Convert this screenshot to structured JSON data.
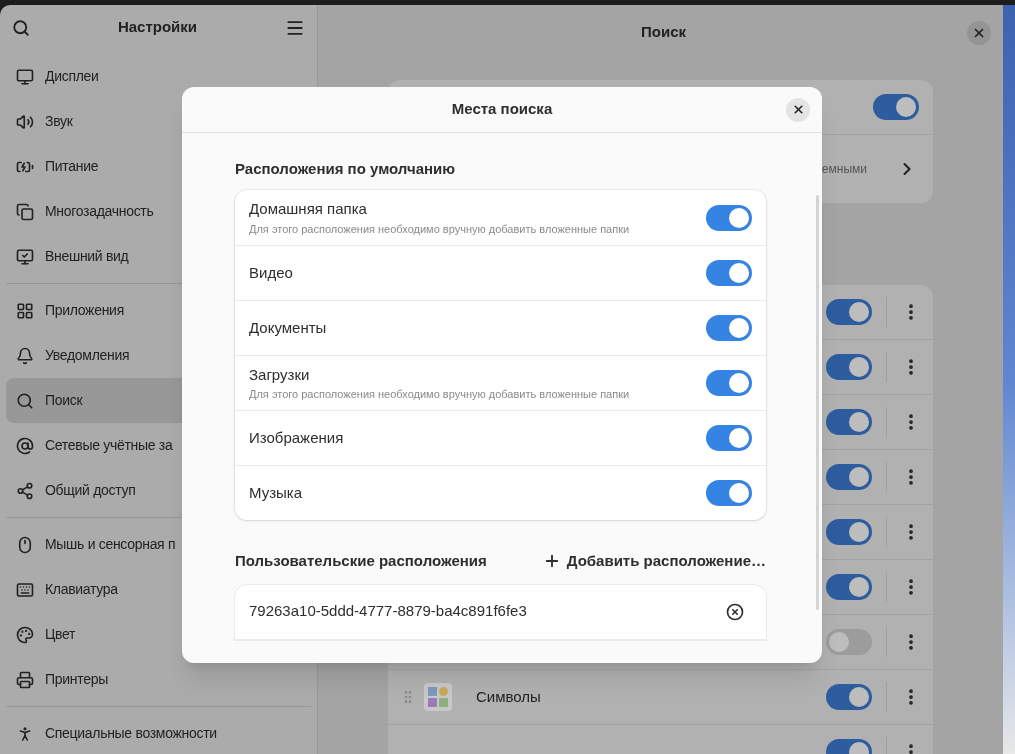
{
  "sidebar": {
    "title": "Настройки",
    "groups": [
      [
        {
          "label": "Дисплеи",
          "selected": false
        },
        {
          "label": "Звук",
          "selected": false
        },
        {
          "label": "Питание",
          "selected": false
        },
        {
          "label": "Многозадачность",
          "selected": false
        },
        {
          "label": "Внешний вид",
          "selected": false
        }
      ],
      [
        {
          "label": "Приложения",
          "selected": false
        },
        {
          "label": "Уведомления",
          "selected": false
        },
        {
          "label": "Поиск",
          "selected": true
        },
        {
          "label": "Сетевые учётные за",
          "selected": false
        },
        {
          "label": "Общий доступ",
          "selected": false
        }
      ],
      [
        {
          "label": "Мышь и сенсорная п",
          "selected": false
        },
        {
          "label": "Клавиатура",
          "selected": false
        },
        {
          "label": "Цвет",
          "selected": false
        },
        {
          "label": "Принтеры",
          "selected": false
        }
      ],
      [
        {
          "label": "Специальные возможности",
          "selected": false
        }
      ]
    ]
  },
  "main": {
    "title": "Поиск",
    "top_card": {
      "toggle_on": true,
      "row_2_text": "емными"
    },
    "apps": [
      {
        "on": true
      },
      {
        "on": true
      },
      {
        "on": true
      },
      {
        "on": true
      },
      {
        "on": true
      },
      {
        "on": true
      },
      {
        "on": false
      },
      {
        "name": "Символы",
        "on": true
      },
      {
        "on": true
      }
    ]
  },
  "dialog": {
    "title": "Места поиска",
    "default_section": {
      "heading": "Расположения по умолчанию",
      "items": [
        {
          "label": "Домашняя папка",
          "subtitle": "Для этого расположения необходимо вручную добавить вложенные папки",
          "on": true
        },
        {
          "label": "Видео",
          "on": true
        },
        {
          "label": "Документы",
          "on": true
        },
        {
          "label": "Загрузки",
          "subtitle": "Для этого расположения необходимо вручную добавить вложенные папки",
          "on": true
        },
        {
          "label": "Изображения",
          "on": true
        },
        {
          "label": "Музыка",
          "on": true
        }
      ]
    },
    "custom_section": {
      "heading": "Пользовательские расположения",
      "add_button": "Добавить расположение…",
      "items": [
        {
          "path": "79263a10-5ddd-4777-8879-ba4c891f6fe3"
        }
      ]
    }
  }
}
